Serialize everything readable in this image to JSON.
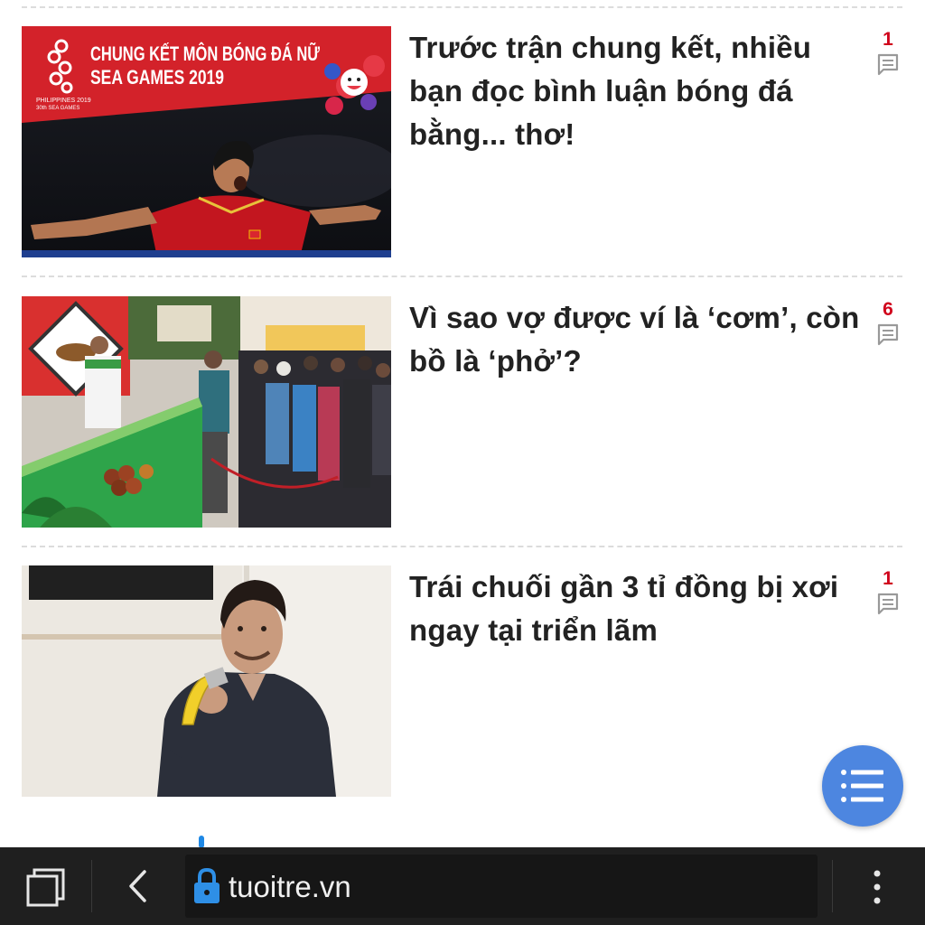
{
  "articles": [
    {
      "title": "Trước trận chung kết, nhiều bạn đọc bình luận bóng đá bằng... thơ!",
      "comment_count": "1",
      "banner_line1": "CHUNG KẾT MÔN BÓNG ĐÁ NỮ",
      "banner_line2": "SEA GAMES 2019",
      "logo_line1": "PHILIPPINES 2019",
      "logo_line2": "30th SEA GAMES"
    },
    {
      "title": "Vì sao vợ được ví là ‘cơm’, còn bồ là ‘phở’?",
      "comment_count": "6"
    },
    {
      "title": "Trái chuối gần 3 tỉ đồng bị xơi ngay tại triển lãm",
      "comment_count": "1"
    }
  ],
  "browser": {
    "url": "tuoitre.vn",
    "icons": [
      "tabs-icon",
      "back-icon",
      "lock-icon",
      "overflow-menu-icon"
    ]
  },
  "fab": {
    "icon": "list-menu-icon",
    "color": "#4d86e0"
  },
  "colors": {
    "comment_count": "#d0021b",
    "toolbar": "#1f1f1f"
  }
}
